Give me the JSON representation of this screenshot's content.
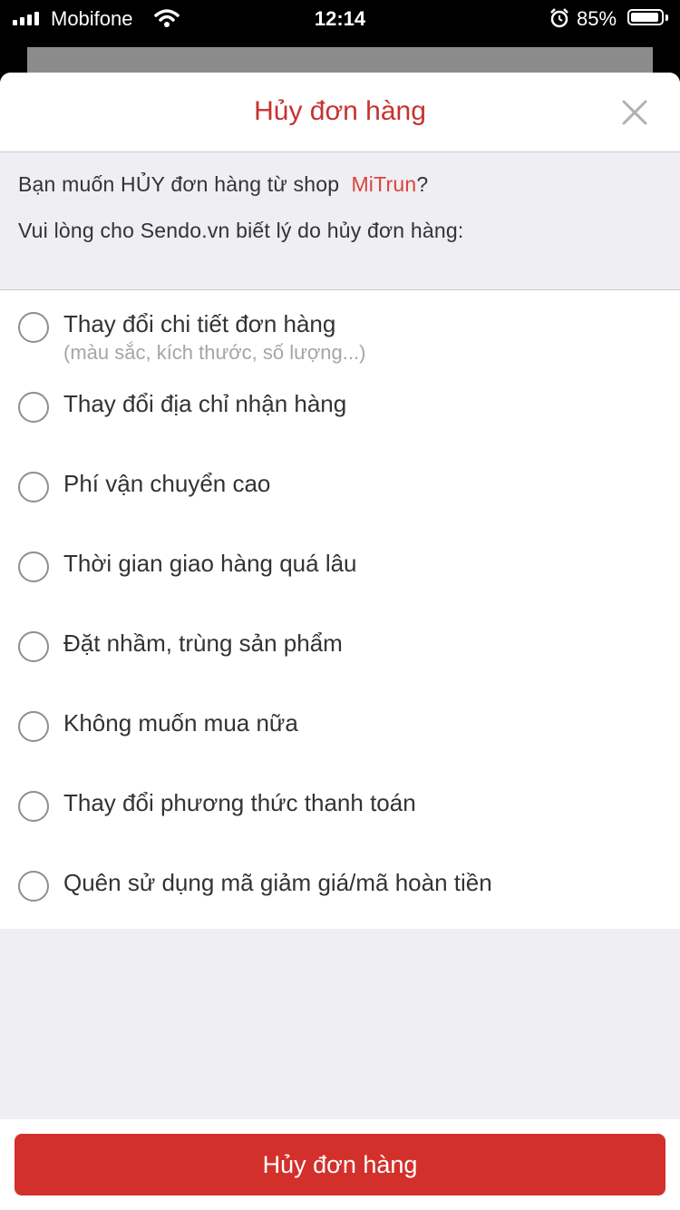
{
  "status_bar": {
    "carrier": "Mobifone",
    "time": "12:14",
    "battery_percent": "85%"
  },
  "sheet": {
    "title": "Hủy đơn hàng",
    "intro": {
      "question_prefix": "Bạn muốn HỦY đơn hàng từ shop",
      "shop_name": "MiTrun",
      "question_suffix": "?",
      "prompt": "Vui lòng cho Sendo.vn biết lý do hủy đơn hàng:"
    },
    "reasons": [
      {
        "label": "Thay đổi chi tiết đơn hàng",
        "sub": "(màu sắc, kích thước, số lượng...)",
        "selected": false
      },
      {
        "label": "Thay đổi địa chỉ nhận hàng",
        "selected": false
      },
      {
        "label": "Phí vận chuyển cao",
        "selected": false
      },
      {
        "label": "Thời gian giao hàng quá lâu",
        "selected": false
      },
      {
        "label": "Đặt nhầm, trùng sản phẩm",
        "selected": false
      },
      {
        "label": "Không muốn mua nữa",
        "selected": false
      },
      {
        "label": "Thay đổi phương thức thanh toán",
        "selected": false
      },
      {
        "label": "Quên sử dụng mã giảm giá/mã hoàn tiền",
        "selected": false
      }
    ],
    "submit_label": "Hủy đơn hàng"
  },
  "colors": {
    "accent": "#d3302b",
    "title_red": "#c8312f",
    "background_gray": "#eeeef3"
  }
}
